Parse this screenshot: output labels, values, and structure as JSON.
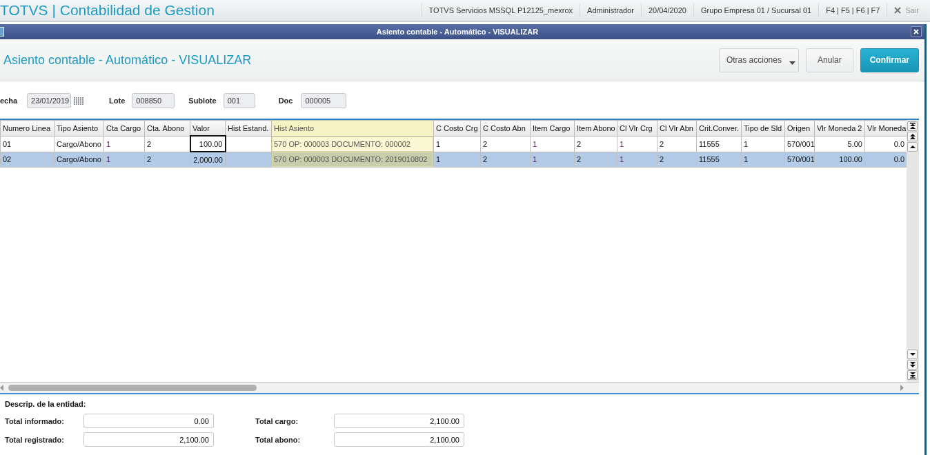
{
  "top_bar": {
    "app_title": "TOTVS | Contabilidad de Gestion",
    "items": [
      "TOTVS Servicios MSSQL P12125_mexrox",
      "Administrador",
      "20/04/2020",
      "Grupo Empresa 01 / Sucursal 01",
      "F4 | F5 | F6 | F7"
    ],
    "exit_label": "Sair"
  },
  "window": {
    "title": "Asiento contable - Automático - VISUALIZAR",
    "heading": "Asiento contable - Automático - VISUALIZAR",
    "buttons": [
      {
        "label": "Otras acciones",
        "kind": "dropdown"
      },
      {
        "label": "Anular",
        "kind": "default"
      },
      {
        "label": "Confirmar",
        "kind": "primary"
      }
    ]
  },
  "fields": [
    {
      "label": "echa",
      "value": "23/01/2019",
      "kind": "date"
    },
    {
      "label": "Lote",
      "value": "008850",
      "kind": "text"
    },
    {
      "label": "Sublote",
      "value": "001",
      "kind": "text"
    },
    {
      "label": "Doc",
      "value": "000005",
      "kind": "text"
    }
  ],
  "table": {
    "columns": [
      {
        "label": "Numero Linea",
        "kind": "text",
        "highlighted": false
      },
      {
        "label": "Tipo Asiento",
        "kind": "text",
        "highlighted": false
      },
      {
        "label": "Cta Cargo",
        "kind": "account",
        "highlighted": false
      },
      {
        "label": "Cta. Abono",
        "kind": "text",
        "highlighted": false
      },
      {
        "label": "Valor",
        "kind": "number",
        "highlighted": false
      },
      {
        "label": "Hist Estand.",
        "kind": "text",
        "highlighted": false
      },
      {
        "label": "Hist Asiento",
        "kind": "text",
        "highlighted": true
      },
      {
        "label": "C Costo Crg",
        "kind": "text",
        "highlighted": false
      },
      {
        "label": "C Costo Abn",
        "kind": "text",
        "highlighted": false
      },
      {
        "label": "Item Cargo",
        "kind": "account",
        "highlighted": false
      },
      {
        "label": "Item Abono",
        "kind": "text",
        "highlighted": false
      },
      {
        "label": "Cl Vlr Crg",
        "kind": "account",
        "highlighted": false
      },
      {
        "label": "Cl Vlr Abn",
        "kind": "text",
        "highlighted": false
      },
      {
        "label": "Crit.Conver.",
        "kind": "text",
        "highlighted": false
      },
      {
        "label": "Tipo de Sld",
        "kind": "text",
        "highlighted": false
      },
      {
        "label": "Origen",
        "kind": "text",
        "highlighted": false
      },
      {
        "label": "Vlr Moneda 2",
        "kind": "number",
        "highlighted": false
      },
      {
        "label": "Vlr Moneda",
        "kind": "number",
        "highlighted": false
      }
    ],
    "rows": [
      {
        "selected": false,
        "cells": [
          {
            "text": "01",
            "focused": false
          },
          {
            "text": "Cargo/Abono",
            "focused": false
          },
          {
            "text": "1",
            "focused": false
          },
          {
            "text": "2",
            "focused": false
          },
          {
            "text": "100.00",
            "focused": true
          },
          {
            "text": "",
            "focused": false
          },
          {
            "text": "570 OP: 000003 DOCUMENTO: 000002",
            "focused": false
          },
          {
            "text": "1",
            "focused": false
          },
          {
            "text": "2",
            "focused": false
          },
          {
            "text": "1",
            "focused": false
          },
          {
            "text": "2",
            "focused": false
          },
          {
            "text": "1",
            "focused": false
          },
          {
            "text": "2",
            "focused": false
          },
          {
            "text": "11555",
            "focused": false
          },
          {
            "text": "1",
            "focused": false
          },
          {
            "text": "570/001",
            "focused": false
          },
          {
            "text": "5.00",
            "focused": false
          },
          {
            "text": "0.0",
            "focused": false
          }
        ]
      },
      {
        "selected": true,
        "cells": [
          {
            "text": "02",
            "focused": false
          },
          {
            "text": "Cargo/Abono",
            "focused": false
          },
          {
            "text": "1",
            "focused": false
          },
          {
            "text": "2",
            "focused": false
          },
          {
            "text": "2,000.00",
            "focused": false
          },
          {
            "text": "",
            "focused": false
          },
          {
            "text": "570 OP: 000003 DOCUMENTO: 2019010802",
            "focused": false
          },
          {
            "text": "1",
            "focused": false
          },
          {
            "text": "2",
            "focused": false
          },
          {
            "text": "1",
            "focused": false
          },
          {
            "text": "2",
            "focused": false
          },
          {
            "text": "1",
            "focused": false
          },
          {
            "text": "2",
            "focused": false
          },
          {
            "text": "11555",
            "focused": false
          },
          {
            "text": "1",
            "focused": false
          },
          {
            "text": "570/001",
            "focused": false
          },
          {
            "text": "100.00",
            "focused": false
          },
          {
            "text": "0.0",
            "focused": false
          }
        ]
      }
    ]
  },
  "footer": {
    "description_label": "Descrip. de la entidad:",
    "totals": [
      {
        "label": "Total informado:",
        "value": "0.00"
      },
      {
        "label": "Total cargo:",
        "value": "2,100.00"
      },
      {
        "label": "Total registrado:",
        "value": "2,100.00"
      },
      {
        "label": "Total abono:",
        "value": "2,100.00"
      }
    ]
  }
}
